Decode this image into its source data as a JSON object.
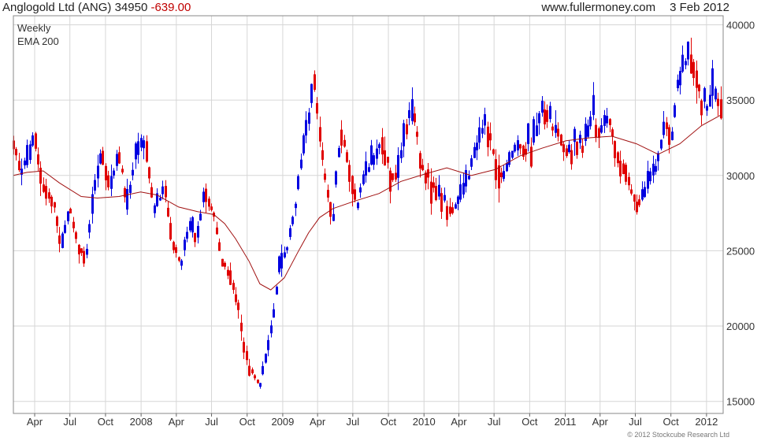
{
  "header": {
    "ticker": "Anglogold Ltd (ANG) 34950",
    "change": "-639.00",
    "source": "www.fullermoney.com",
    "date": "3 Feb 2012"
  },
  "copyright": "© 2012 Stockcube Research Ltd",
  "chart_data": {
    "type": "candlestick",
    "legend": [
      "Weekly",
      "EMA 200"
    ],
    "up_color": "#0000e0",
    "down_color": "#e00000",
    "ema_color": "#a01010",
    "grid": true,
    "yaxis_side": "right",
    "ylim": [
      14200,
      40600
    ],
    "yticks": [
      15000,
      20000,
      25000,
      30000,
      35000,
      40000
    ],
    "xlim": [
      "2007-02-05",
      "2012-02-13"
    ],
    "xticks": [
      {
        "label": "Apr",
        "date": "2007-04-01"
      },
      {
        "label": "Jul",
        "date": "2007-07-01"
      },
      {
        "label": "Oct",
        "date": "2007-10-01"
      },
      {
        "label": "2008",
        "date": "2008-01-01"
      },
      {
        "label": "Apr",
        "date": "2008-04-01"
      },
      {
        "label": "Jul",
        "date": "2008-07-01"
      },
      {
        "label": "Oct",
        "date": "2008-10-01"
      },
      {
        "label": "2009",
        "date": "2009-01-01"
      },
      {
        "label": "Apr",
        "date": "2009-04-01"
      },
      {
        "label": "Jul",
        "date": "2009-07-01"
      },
      {
        "label": "Oct",
        "date": "2009-10-01"
      },
      {
        "label": "2010",
        "date": "2010-01-01"
      },
      {
        "label": "Apr",
        "date": "2010-04-01"
      },
      {
        "label": "Jul",
        "date": "2010-07-01"
      },
      {
        "label": "Oct",
        "date": "2010-10-01"
      },
      {
        "label": "2011",
        "date": "2011-01-01"
      },
      {
        "label": "Apr",
        "date": "2011-04-01"
      },
      {
        "label": "Jul",
        "date": "2011-07-01"
      },
      {
        "label": "Oct",
        "date": "2011-10-01"
      },
      {
        "label": "2012",
        "date": "2012-01-01"
      }
    ],
    "price_path": [
      [
        "2007-02-05",
        32500
      ],
      [
        "2007-02-26",
        30200
      ],
      [
        "2007-03-19",
        31200
      ],
      [
        "2007-04-01",
        32800
      ],
      [
        "2007-04-23",
        29500
      ],
      [
        "2007-05-21",
        28200
      ],
      [
        "2007-06-11",
        25300
      ],
      [
        "2007-07-01",
        27800
      ],
      [
        "2007-07-23",
        25500
      ],
      [
        "2007-08-13",
        24700
      ],
      [
        "2007-09-03",
        28800
      ],
      [
        "2007-09-24",
        31800
      ],
      [
        "2007-10-15",
        29200
      ],
      [
        "2007-11-05",
        31600
      ],
      [
        "2007-11-26",
        27800
      ],
      [
        "2007-12-17",
        31200
      ],
      [
        "2008-01-14",
        32300
      ],
      [
        "2008-02-04",
        27500
      ],
      [
        "2008-03-03",
        29200
      ],
      [
        "2008-03-24",
        25800
      ],
      [
        "2008-04-14",
        24100
      ],
      [
        "2008-05-05",
        26500
      ],
      [
        "2008-05-26",
        26100
      ],
      [
        "2008-06-16",
        28900
      ],
      [
        "2008-07-07",
        27500
      ],
      [
        "2008-07-28",
        24500
      ],
      [
        "2008-08-18",
        23500
      ],
      [
        "2008-09-08",
        21600
      ],
      [
        "2008-09-22",
        19000
      ],
      [
        "2008-10-06",
        17500
      ],
      [
        "2008-10-20",
        16800
      ],
      [
        "2008-11-03",
        16000
      ],
      [
        "2008-11-24",
        18500
      ],
      [
        "2008-12-08",
        20500
      ],
      [
        "2008-12-22",
        23500
      ],
      [
        "2009-01-12",
        25000
      ],
      [
        "2009-02-02",
        27800
      ],
      [
        "2009-02-23",
        31500
      ],
      [
        "2009-03-09",
        33500
      ],
      [
        "2009-03-23",
        36500
      ],
      [
        "2009-04-06",
        33000
      ],
      [
        "2009-04-20",
        30000
      ],
      [
        "2009-05-11",
        27200
      ],
      [
        "2009-06-01",
        33200
      ],
      [
        "2009-06-22",
        30800
      ],
      [
        "2009-07-13",
        27900
      ],
      [
        "2009-08-03",
        30200
      ],
      [
        "2009-08-24",
        30600
      ],
      [
        "2009-09-14",
        32500
      ],
      [
        "2009-10-05",
        30500
      ],
      [
        "2009-10-26",
        29700
      ],
      [
        "2009-11-16",
        33500
      ],
      [
        "2009-12-07",
        34100
      ],
      [
        "2009-12-28",
        30600
      ],
      [
        "2010-01-18",
        29900
      ],
      [
        "2010-02-08",
        28800
      ],
      [
        "2010-03-01",
        28100
      ],
      [
        "2010-03-22",
        27900
      ],
      [
        "2010-04-12",
        28500
      ],
      [
        "2010-05-03",
        30500
      ],
      [
        "2010-05-24",
        32200
      ],
      [
        "2010-06-14",
        33500
      ],
      [
        "2010-07-05",
        31000
      ],
      [
        "2010-07-26",
        29900
      ],
      [
        "2010-08-16",
        31200
      ],
      [
        "2010-09-06",
        32000
      ],
      [
        "2010-09-27",
        31800
      ],
      [
        "2010-10-18",
        32900
      ],
      [
        "2010-11-08",
        34600
      ],
      [
        "2010-11-29",
        33400
      ],
      [
        "2010-12-20",
        32500
      ],
      [
        "2011-01-10",
        31500
      ],
      [
        "2011-01-31",
        32300
      ],
      [
        "2011-02-21",
        32000
      ],
      [
        "2011-03-14",
        34000
      ],
      [
        "2011-04-04",
        32700
      ],
      [
        "2011-04-25",
        33800
      ],
      [
        "2011-05-16",
        31500
      ],
      [
        "2011-06-06",
        30500
      ],
      [
        "2011-06-27",
        28500
      ],
      [
        "2011-07-18",
        28200
      ],
      [
        "2011-08-08",
        29500
      ],
      [
        "2011-08-29",
        30800
      ],
      [
        "2011-09-19",
        33500
      ],
      [
        "2011-10-03",
        32500
      ],
      [
        "2011-10-17",
        35500
      ],
      [
        "2011-11-07",
        37200
      ],
      [
        "2011-11-21",
        38100
      ],
      [
        "2011-12-05",
        36800
      ],
      [
        "2011-12-19",
        35000
      ],
      [
        "2012-01-02",
        34400
      ],
      [
        "2012-01-16",
        35100
      ],
      [
        "2012-02-06",
        34950
      ]
    ],
    "ema_200": [
      [
        "2007-02-05",
        30000
      ],
      [
        "2007-03-12",
        30200
      ],
      [
        "2007-04-23",
        30300
      ],
      [
        "2007-06-04",
        29500
      ],
      [
        "2007-07-30",
        28600
      ],
      [
        "2007-09-10",
        28500
      ],
      [
        "2007-11-05",
        28600
      ],
      [
        "2007-12-31",
        28900
      ],
      [
        "2008-02-11",
        28700
      ],
      [
        "2008-04-07",
        27900
      ],
      [
        "2008-05-26",
        27600
      ],
      [
        "2008-07-07",
        27400
      ],
      [
        "2008-08-04",
        26800
      ],
      [
        "2008-09-01",
        25800
      ],
      [
        "2008-10-06",
        24300
      ],
      [
        "2008-11-03",
        22800
      ],
      [
        "2008-12-01",
        22400
      ],
      [
        "2009-01-05",
        23200
      ],
      [
        "2009-02-09",
        24900
      ],
      [
        "2009-03-09",
        26200
      ],
      [
        "2009-04-06",
        27200
      ],
      [
        "2009-05-11",
        27800
      ],
      [
        "2009-07-06",
        28300
      ],
      [
        "2009-09-07",
        28800
      ],
      [
        "2009-11-02",
        29600
      ],
      [
        "2010-01-04",
        30100
      ],
      [
        "2010-03-01",
        30500
      ],
      [
        "2010-05-03",
        30000
      ],
      [
        "2010-07-05",
        30400
      ],
      [
        "2010-09-06",
        31300
      ],
      [
        "2010-11-01",
        31800
      ],
      [
        "2011-01-03",
        32300
      ],
      [
        "2011-03-07",
        32500
      ],
      [
        "2011-05-02",
        32600
      ],
      [
        "2011-07-04",
        32100
      ],
      [
        "2011-08-29",
        31400
      ],
      [
        "2011-10-24",
        32100
      ],
      [
        "2011-12-19",
        33300
      ],
      [
        "2012-02-06",
        34000
      ]
    ]
  }
}
